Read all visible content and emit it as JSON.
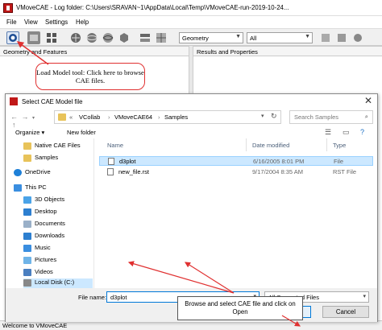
{
  "app": {
    "title": "VMoveCAE - Log folder: C:\\Users\\SRAVAN~1\\AppData\\Local\\Temp\\VMoveCAE-run-2019-10-24...",
    "menu": [
      "File",
      "View",
      "Settings",
      "Help"
    ],
    "combo_geometry": "Geometry",
    "combo_all": "All",
    "panel_left": "Geometry and Features",
    "panel_right": "Results and Properties",
    "status": "Welcome to VMoveCAE"
  },
  "callouts": {
    "load_model": "Load Model tool: Click here to browse CAE files.",
    "browse": "Browse and select CAE file and click on Open"
  },
  "dialog": {
    "title": "Select CAE Model file",
    "breadcrumb": [
      "«",
      "VCollab",
      "VMoveCAE64",
      "Samples"
    ],
    "search_placeholder": "Search Samples",
    "organize": "Organize ▾",
    "new_folder": "New folder",
    "nav": [
      "Native CAE Files",
      "Samples",
      "OneDrive",
      "This PC",
      "3D Objects",
      "Desktop",
      "Documents",
      "Downloads",
      "Music",
      "Pictures",
      "Videos",
      "Local Disk (C:)"
    ],
    "columns": [
      "Name",
      "Date modified",
      "Type"
    ],
    "files": [
      {
        "name": "d3plot",
        "date": "6/16/2005 8:01 PM",
        "type": "File"
      },
      {
        "name": "new_file.rst",
        "date": "9/17/2004 8:35 AM",
        "type": "RST File"
      }
    ],
    "file_name_label": "File name:",
    "file_name_value": "d3plot",
    "file_type": "All Supported Files",
    "open": "Open",
    "cancel": "Cancel"
  },
  "colors": {
    "accent": "#0078d7",
    "callout_border": "#e03030",
    "arrow": "#e03030"
  }
}
